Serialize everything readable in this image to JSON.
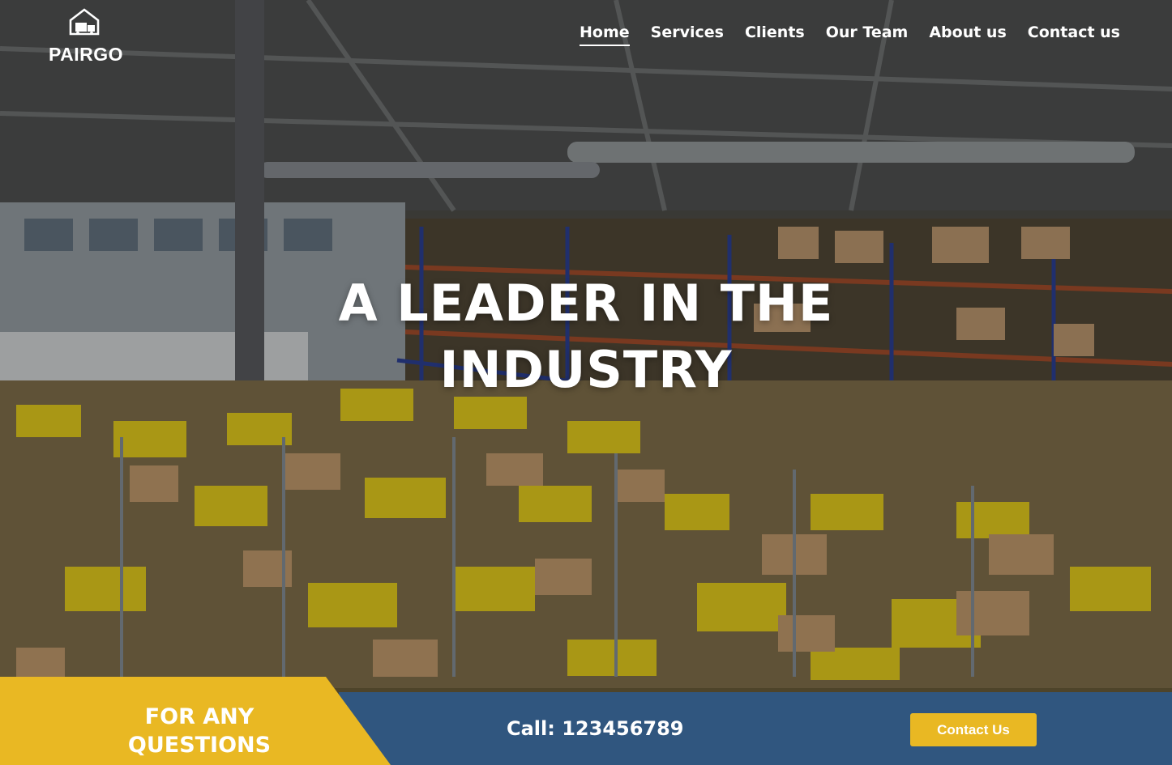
{
  "brand": {
    "name": "PAIRGO",
    "logo_icon": "warehouse-truck-icon"
  },
  "nav": {
    "items": [
      {
        "label": "Home",
        "active": true
      },
      {
        "label": "Services",
        "active": false
      },
      {
        "label": "Clients",
        "active": false
      },
      {
        "label": "Our Team",
        "active": false
      },
      {
        "label": "About us",
        "active": false
      },
      {
        "label": "Contact us",
        "active": false
      }
    ]
  },
  "hero": {
    "headline_line1": "A LEADER IN THE",
    "headline_line2": "INDUSTRY",
    "background": "warehouse-photo"
  },
  "cta": {
    "question_line1": "FOR ANY",
    "question_line2": "QUESTIONS",
    "call_text": "Call: 123456789",
    "button_label": "Contact Us"
  },
  "colors": {
    "accent_yellow": "#e9b823",
    "band_blue": "#30567f",
    "text_white": "#ffffff"
  }
}
